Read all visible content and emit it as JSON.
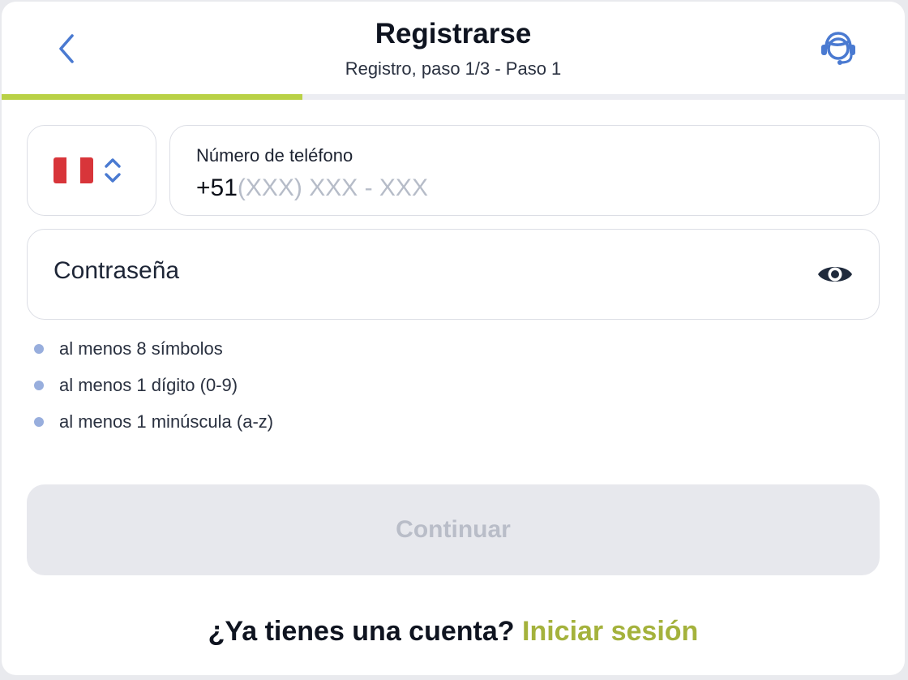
{
  "header": {
    "title": "Registrarse",
    "subtitle": "Registro, paso 1/3 - Paso 1",
    "progress_fraction": 0.333
  },
  "phone": {
    "country_flag": "peru-flag-icon",
    "flag_colors": [
      "#d8353a",
      "#ffffff",
      "#d8353a"
    ],
    "label": "Número de teléfono",
    "prefix": "+51",
    "placeholder": "(XXX) XXX - XXX"
  },
  "password": {
    "placeholder": "Contraseña"
  },
  "rules": [
    "al menos 8 símbolos",
    "al menos 1 dígito (0-9)",
    "al menos 1 minúscula (a-z)"
  ],
  "continue_label": "Continuar",
  "login": {
    "question": "¿Ya tienes una cuenta?",
    "link": "Iniciar sesión"
  },
  "colors": {
    "accent": "#b9d146",
    "link": "#a4b23c",
    "icon_blue": "#4a7ad1",
    "rule_dot": "#98aedd"
  }
}
